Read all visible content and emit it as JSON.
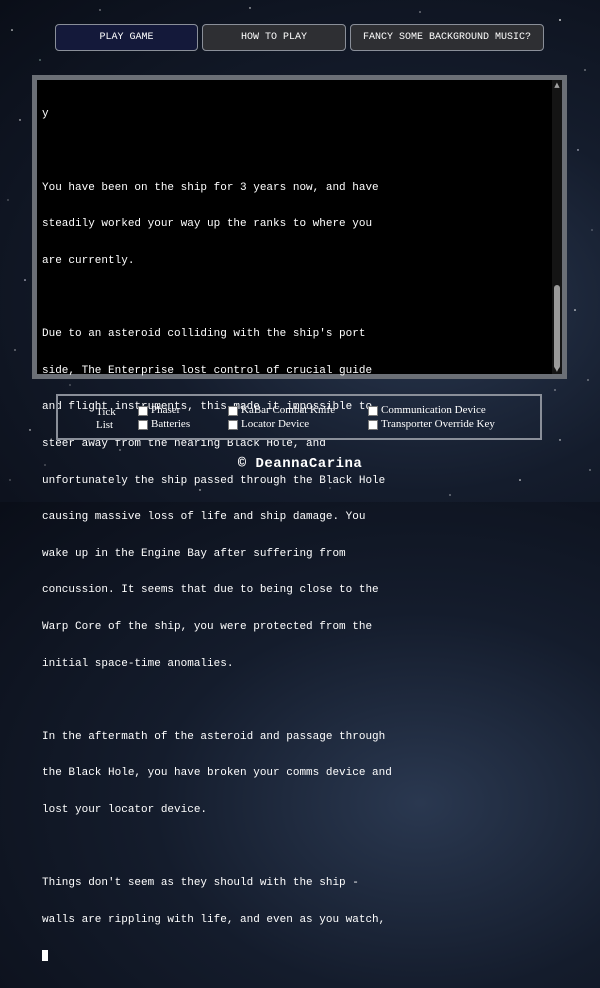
{
  "tabs": [
    {
      "label": "PLAY GAME",
      "active": true
    },
    {
      "label": "HOW TO PLAY",
      "active": false
    },
    {
      "label": "FANCY SOME BACKGROUND MUSIC?",
      "active": false
    }
  ],
  "terminal": {
    "lines": [
      "y",
      "",
      "You have been on the ship for 3 years now, and have",
      "steadily worked your way up the ranks to where you",
      "are currently.",
      "",
      "Due to an asteroid colliding with the ship's port",
      "side, The Enterprise lost control of crucial guide",
      "and flight instruments, this made it impossible to",
      "steer away from the nearing Black Hole, and",
      "unfortunately the ship passed through the Black Hole",
      "causing massive loss of life and ship damage. You",
      "wake up in the Engine Bay after suffering from",
      "concussion. It seems that due to being close to the",
      "Warp Core of the ship, you were protected from the",
      "initial space-time anomalies.",
      "",
      "In the aftermath of the asteroid and passage through",
      "the Black Hole, you have broken your comms device and",
      "lost your locator device.",
      "",
      "Things don't seem as they should with the ship -",
      "walls are rippling with life, and even as you watch,"
    ]
  },
  "inventory": {
    "title_line1": "Tick",
    "title_line2": "List",
    "items": [
      {
        "label": "Phaser"
      },
      {
        "label": "KaBar Combat Knife"
      },
      {
        "label": "Communication Device"
      },
      {
        "label": "Batteries"
      },
      {
        "label": "Locator Device"
      },
      {
        "label": "Transporter Override Key"
      }
    ]
  },
  "footer": {
    "text": "© DeannaCarina"
  }
}
